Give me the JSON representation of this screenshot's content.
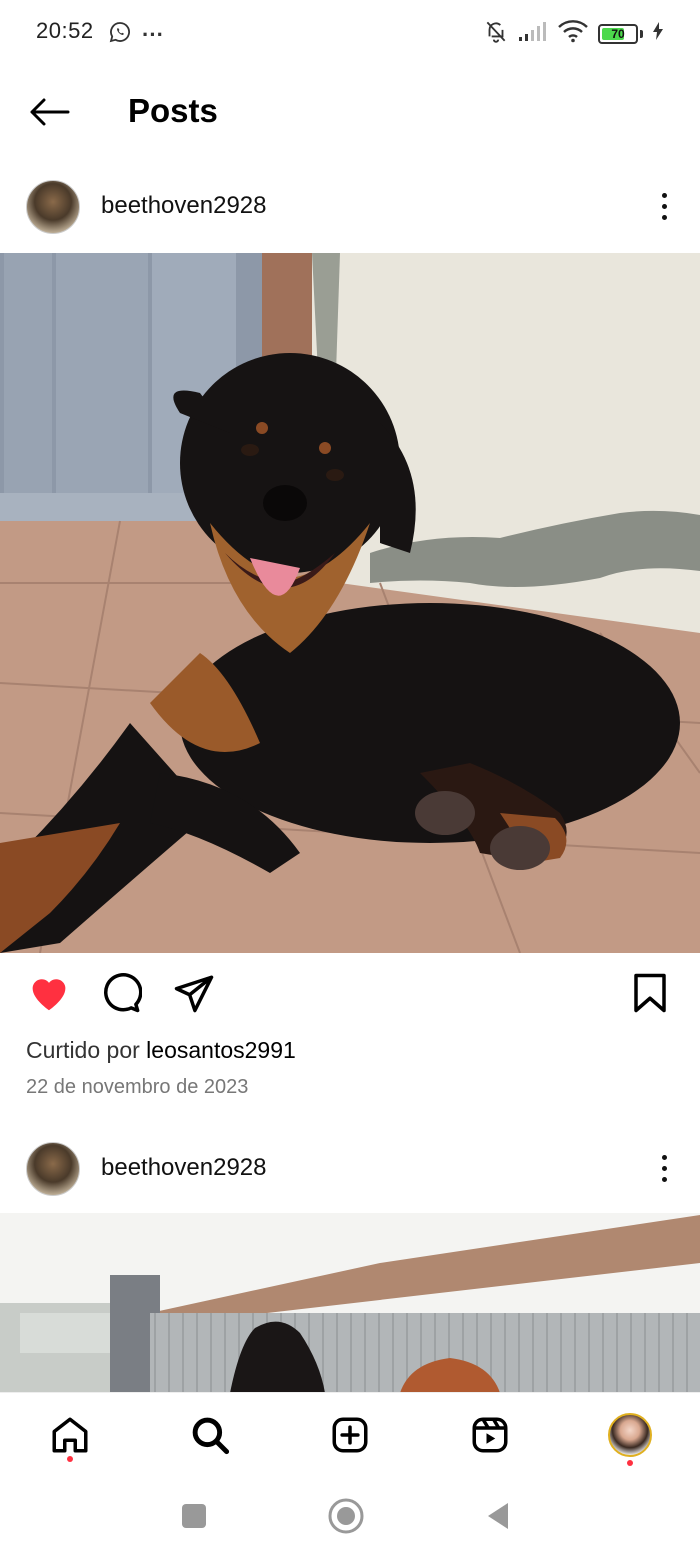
{
  "status_bar": {
    "time": "20:52",
    "more": "···",
    "battery_level": "70",
    "battery_fraction": 0.7,
    "battery_color": "#4cd94c",
    "icons": [
      "whatsapp-icon",
      "bell-off-icon",
      "signal-icon",
      "wifi-icon",
      "battery-icon",
      "charging-icon"
    ]
  },
  "header": {
    "title": "Posts",
    "back_icon": "arrow-left-icon"
  },
  "posts": [
    {
      "username": "beethoven2928",
      "liked_prefix": "Curtido por ",
      "liked_by": "leosantos2991",
      "date": "22 de novembro de 2023",
      "liked": true
    },
    {
      "username": "beethoven2928"
    }
  ],
  "bottom_nav": {
    "items": [
      "home-icon",
      "search-icon",
      "create-icon",
      "reels-icon",
      "profile-avatar"
    ],
    "notification_color": "#ff3040"
  },
  "colors": {
    "like_red": "#ff3040",
    "text": "#000000",
    "secondary_text": "#777777"
  }
}
